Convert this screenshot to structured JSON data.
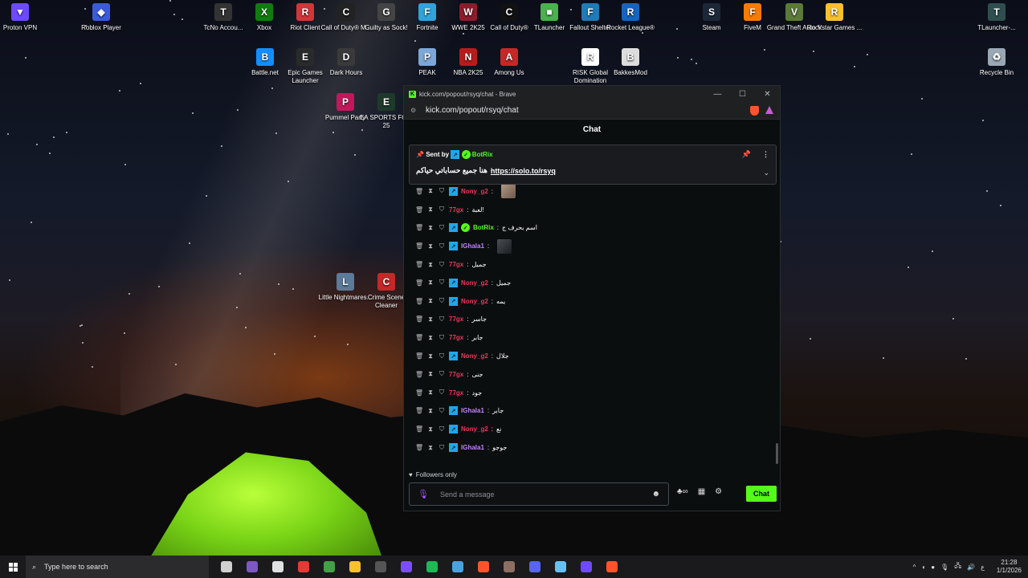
{
  "desktop": {
    "icons": [
      {
        "label": "Proton VPN",
        "glyph": "▼",
        "color": "#6d4aff"
      },
      {
        "label": "Roblox Player",
        "glyph": "◆",
        "color": "#3b5bdb"
      },
      {
        "label": "TcNo Accou...",
        "glyph": "T",
        "color": "#333333"
      },
      {
        "label": "Xbox",
        "glyph": "X",
        "color": "#107c10"
      },
      {
        "label": "Riot Client",
        "glyph": "R",
        "color": "#d13639"
      },
      {
        "label": "Call of Duty® M...",
        "glyph": "C",
        "color": "#222222"
      },
      {
        "label": "Guilty as Sock!",
        "glyph": "G",
        "color": "#444444"
      },
      {
        "label": "Fortnite",
        "glyph": "F",
        "color": "#2fa4d8"
      },
      {
        "label": "WWE 2K25",
        "glyph": "W",
        "color": "#8b1c2b"
      },
      {
        "label": "Call of Duty®",
        "glyph": "C",
        "color": "#111111"
      },
      {
        "label": "TLauncher",
        "glyph": "■",
        "color": "#4caf50"
      },
      {
        "label": "Fallout Shelter",
        "glyph": "F",
        "color": "#1f7ab8"
      },
      {
        "label": "Rocket League®",
        "glyph": "R",
        "color": "#1565c0"
      },
      {
        "label": "Steam",
        "glyph": "S",
        "color": "#1b2838"
      },
      {
        "label": "FiveM",
        "glyph": "F",
        "color": "#f57c00"
      },
      {
        "label": "Grand Theft Auto V",
        "glyph": "V",
        "color": "#5b7a3a"
      },
      {
        "label": "Rockstar Games ...",
        "glyph": "R",
        "color": "#fbc02d"
      },
      {
        "label": "TLauncher-...",
        "glyph": "T",
        "color": "#2f4f4f"
      },
      {
        "label": "Battle.net",
        "glyph": "B",
        "color": "#148eff"
      },
      {
        "label": "Epic Games Launcher",
        "glyph": "E",
        "color": "#2a2a2a"
      },
      {
        "label": "Dark Hours",
        "glyph": "D",
        "color": "#3a3a3a"
      },
      {
        "label": "PEAK",
        "glyph": "P",
        "color": "#7da7d9"
      },
      {
        "label": "NBA 2K25",
        "glyph": "N",
        "color": "#b71c1c"
      },
      {
        "label": "Among Us",
        "glyph": "A",
        "color": "#c62828"
      },
      {
        "label": "RISK Global Domination",
        "glyph": "R",
        "color": "#ffffff"
      },
      {
        "label": "BakkesMod",
        "glyph": "B",
        "color": "#dddddd"
      },
      {
        "label": "Recycle Bin",
        "glyph": "♻",
        "color": "#9aa7b5"
      },
      {
        "label": "Pummel Party",
        "glyph": "P",
        "color": "#c2185b"
      },
      {
        "label": "EA SPORTS FC™ 25",
        "glyph": "E",
        "color": "#1f3a2a"
      },
      {
        "label": "Little Nightmares...",
        "glyph": "L",
        "color": "#5c7a99"
      },
      {
        "label": "Crime Scene Cleaner",
        "glyph": "C",
        "color": "#c62828"
      }
    ]
  },
  "browser": {
    "tab_title": "kick.com/popout/rsyq/chat - Brave",
    "url": "kick.com/popout/rsyq/chat"
  },
  "chat": {
    "header": "Chat",
    "pinned": {
      "sent_by": "Sent by",
      "author": "BotRix",
      "text": "هنا جميع حساباتي حياكم",
      "link": "https://solo.to/rsyq"
    },
    "messages": [
      {
        "user": "Nony_g2",
        "color": "#e8365d",
        "badge": true,
        "text": "",
        "emote": "light"
      },
      {
        "user": "77gx",
        "color": "#e8365d",
        "badge": false,
        "text": "لعبة!"
      },
      {
        "user": "BotRix",
        "color": "#53fc18",
        "badge": true,
        "bot": true,
        "text": "اسم بحرف ج"
      },
      {
        "user": "IGhala1",
        "color": "#c084fc",
        "badge": true,
        "text": "",
        "emote": "dark"
      },
      {
        "user": "77gx",
        "color": "#e8365d",
        "badge": false,
        "text": "جميل"
      },
      {
        "user": "Nony_g2",
        "color": "#e8365d",
        "badge": true,
        "text": "جميل"
      },
      {
        "user": "Nony_g2",
        "color": "#e8365d",
        "badge": true,
        "text": "يمه"
      },
      {
        "user": "77gx",
        "color": "#e8365d",
        "badge": false,
        "text": "جاسر"
      },
      {
        "user": "77gx",
        "color": "#e8365d",
        "badge": false,
        "text": "جابر"
      },
      {
        "user": "Nony_g2",
        "color": "#e8365d",
        "badge": true,
        "text": "جلال"
      },
      {
        "user": "77gx",
        "color": "#e8365d",
        "badge": false,
        "text": "جنى"
      },
      {
        "user": "77gx",
        "color": "#e8365d",
        "badge": false,
        "text": "جود"
      },
      {
        "user": "IGhala1",
        "color": "#c084fc",
        "badge": true,
        "text": "جابر"
      },
      {
        "user": "Nony_g2",
        "color": "#e8365d",
        "badge": true,
        "text": "نع"
      },
      {
        "user": "IGhala1",
        "color": "#c084fc",
        "badge": true,
        "text": "جوجو"
      }
    ],
    "followers_only": "Followers only",
    "input_placeholder": "Send a message",
    "send_label": "Chat"
  },
  "taskbar": {
    "search_placeholder": "Type here to search",
    "time": "21:28",
    "date": "1/1/2026",
    "lang": "ع",
    "apps": [
      {
        "name": "task-view",
        "color": "#d0d0d0"
      },
      {
        "name": "game-app",
        "color": "#7e57c2"
      },
      {
        "name": "steamvr",
        "color": "#e0e0e0"
      },
      {
        "name": "opera",
        "color": "#e53935"
      },
      {
        "name": "chrome",
        "color": "#43a047"
      },
      {
        "name": "file-explorer",
        "color": "#fbc02d"
      },
      {
        "name": "obs",
        "color": "#555555"
      },
      {
        "name": "messenger",
        "color": "#7c4dff"
      },
      {
        "name": "spotify",
        "color": "#1db954"
      },
      {
        "name": "app-window",
        "color": "#4aa3df"
      },
      {
        "name": "brave",
        "color": "#fb542b"
      },
      {
        "name": "game-launcher",
        "color": "#8d6e63"
      },
      {
        "name": "discord",
        "color": "#5865f2"
      },
      {
        "name": "steam",
        "color": "#66c0f4"
      },
      {
        "name": "proton",
        "color": "#6d4aff"
      },
      {
        "name": "brave-active",
        "color": "#fb542b"
      }
    ]
  }
}
